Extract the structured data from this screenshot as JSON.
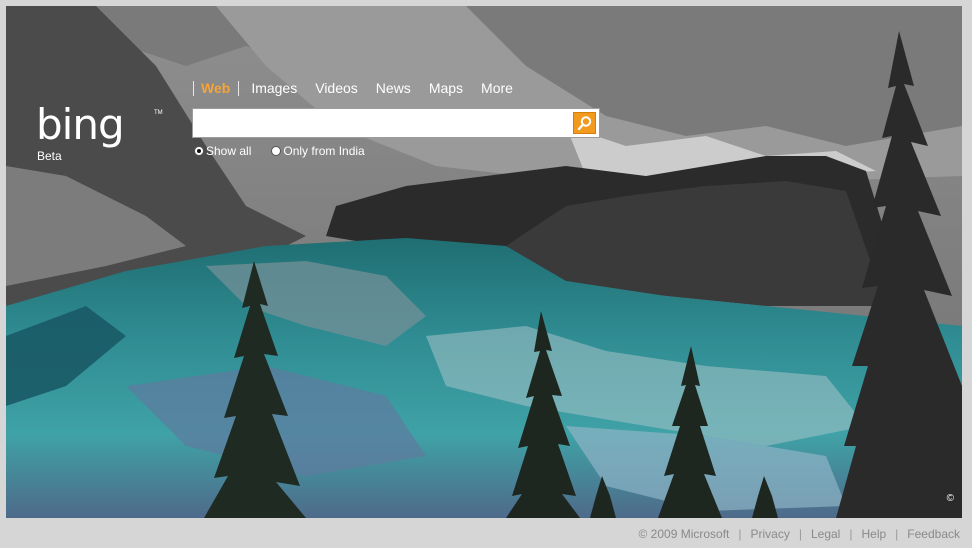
{
  "brand": {
    "logo_text": "bing",
    "tm": "TM",
    "beta": "Beta"
  },
  "scopes": [
    {
      "label": "Web",
      "active": true
    },
    {
      "label": "Images",
      "active": false
    },
    {
      "label": "Videos",
      "active": false
    },
    {
      "label": "News",
      "active": false
    },
    {
      "label": "Maps",
      "active": false
    },
    {
      "label": "More",
      "active": false
    }
  ],
  "search": {
    "value": "",
    "placeholder": "",
    "button_icon": "magnifier-icon"
  },
  "filters": {
    "show_all": "Show all",
    "only_india": "Only from India",
    "selected": "show_all"
  },
  "hero": {
    "copyright_glyph": "©"
  },
  "footer": {
    "copyright": "© 2009 Microsoft",
    "privacy": "Privacy",
    "legal": "Legal",
    "help": "Help",
    "feedback": "Feedback",
    "separator": "|"
  },
  "colors": {
    "accent": "#f5a33a",
    "search_button": "#f29a1e",
    "footer_text": "#8a8a8a"
  }
}
